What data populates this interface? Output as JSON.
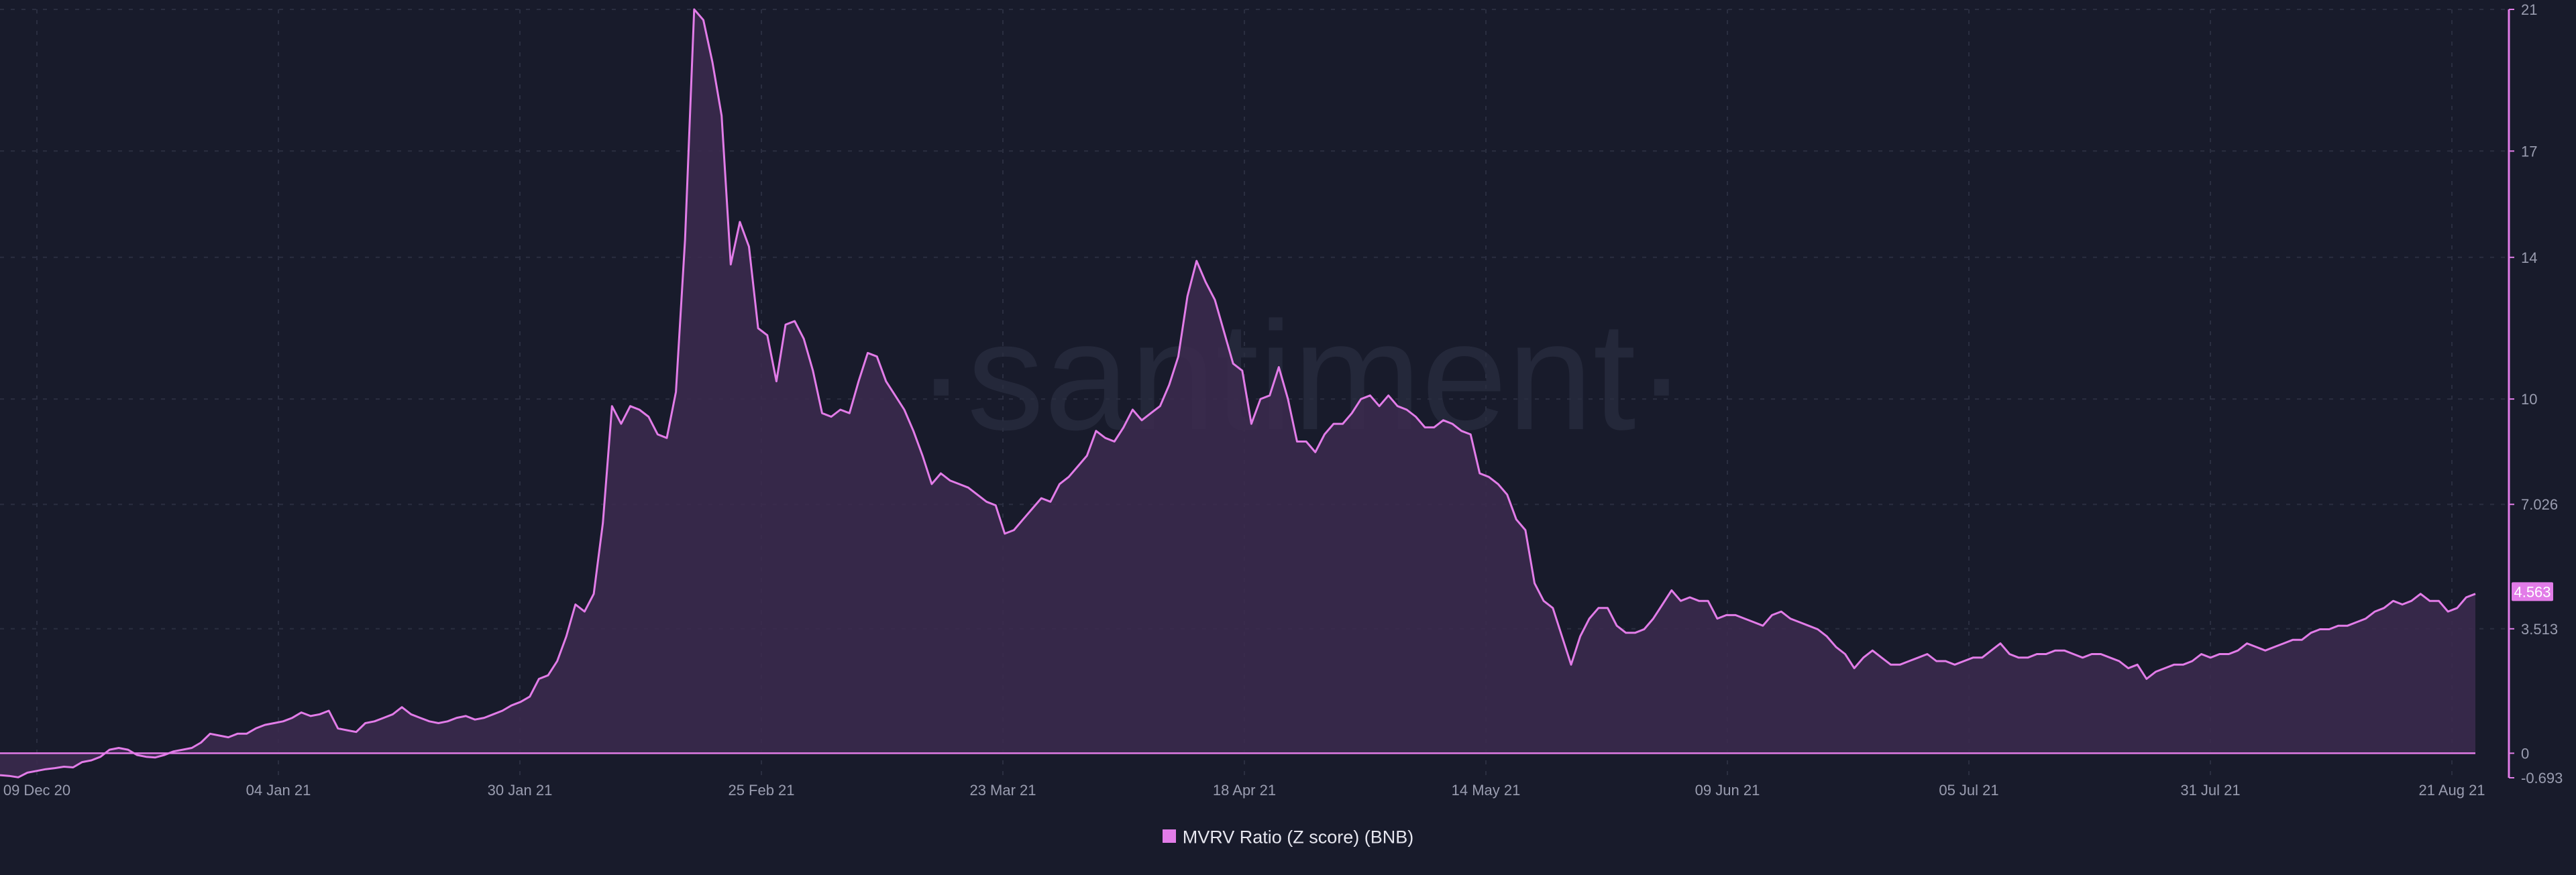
{
  "chart_data": {
    "type": "area",
    "watermark": "·santiment·",
    "x_ticks": [
      "09 Dec 20",
      "04 Jan 21",
      "30 Jan 21",
      "25 Feb 21",
      "23 Mar 21",
      "18 Apr 21",
      "14 May 21",
      "09 Jun 21",
      "05 Jul 21",
      "31 Jul 21",
      "21 Aug 21"
    ],
    "y_ticks": [
      21,
      17,
      14,
      10,
      7.026,
      3.513,
      0,
      -0.693
    ],
    "ylim": [
      -0.693,
      21
    ],
    "current_value": "4.563",
    "legend_position": "bottom-center",
    "grid": true,
    "colors": {
      "background": "#181b2b",
      "line": "#e27ce8",
      "fill": "#3c2a4f",
      "grid": "#2a2e40"
    },
    "series": [
      {
        "name": "MVRV Ratio (Z score) (BNB)",
        "x_start": "2020-12-09",
        "x_end": "2021-08-21",
        "values": [
          -0.62,
          -0.64,
          -0.68,
          -0.55,
          -0.5,
          -0.45,
          -0.42,
          -0.38,
          -0.4,
          -0.25,
          -0.2,
          -0.1,
          0.1,
          0.15,
          0.1,
          -0.05,
          -0.1,
          -0.12,
          -0.05,
          0.05,
          0.1,
          0.15,
          0.3,
          0.55,
          0.5,
          0.45,
          0.55,
          0.55,
          0.7,
          0.8,
          0.85,
          0.9,
          1.0,
          1.15,
          1.05,
          1.1,
          1.2,
          0.7,
          0.65,
          0.6,
          0.85,
          0.9,
          1.0,
          1.1,
          1.3,
          1.1,
          1.0,
          0.9,
          0.85,
          0.9,
          1.0,
          1.05,
          0.95,
          1.0,
          1.1,
          1.2,
          1.35,
          1.45,
          1.6,
          2.1,
          2.2,
          2.6,
          3.3,
          4.2,
          4.0,
          4.5,
          6.5,
          9.8,
          9.3,
          9.8,
          9.7,
          9.5,
          9.0,
          8.9,
          10.2,
          14.5,
          21.0,
          20.7,
          19.5,
          18.0,
          13.8,
          15.0,
          14.3,
          12.0,
          11.8,
          10.5,
          12.1,
          12.2,
          11.7,
          10.8,
          9.6,
          9.5,
          9.7,
          9.6,
          10.5,
          11.3,
          11.2,
          10.5,
          10.1,
          9.7,
          9.1,
          8.4,
          7.6,
          7.9,
          7.7,
          7.6,
          7.5,
          7.3,
          7.1,
          7.0,
          6.2,
          6.3,
          6.6,
          6.9,
          7.2,
          7.1,
          7.6,
          7.8,
          8.1,
          8.4,
          9.1,
          8.9,
          8.8,
          9.2,
          9.7,
          9.4,
          9.6,
          9.8,
          10.4,
          11.2,
          12.9,
          13.9,
          13.3,
          12.8,
          11.9,
          11.0,
          10.8,
          9.3,
          10.0,
          10.1,
          10.9,
          10.0,
          8.8,
          8.8,
          8.5,
          9.0,
          9.3,
          9.3,
          9.6,
          10.0,
          10.1,
          9.8,
          10.1,
          9.8,
          9.7,
          9.5,
          9.2,
          9.2,
          9.4,
          9.3,
          9.1,
          9.0,
          7.9,
          7.8,
          7.6,
          7.3,
          6.6,
          6.3,
          4.8,
          4.3,
          4.1,
          3.3,
          2.5,
          3.3,
          3.8,
          4.1,
          4.1,
          3.6,
          3.4,
          3.4,
          3.5,
          3.8,
          4.2,
          4.6,
          4.3,
          4.4,
          4.3,
          4.3,
          3.8,
          3.9,
          3.9,
          3.8,
          3.7,
          3.6,
          3.9,
          4.0,
          3.8,
          3.7,
          3.6,
          3.5,
          3.3,
          3.0,
          2.8,
          2.4,
          2.7,
          2.9,
          2.7,
          2.5,
          2.5,
          2.6,
          2.7,
          2.8,
          2.6,
          2.6,
          2.5,
          2.6,
          2.7,
          2.7,
          2.9,
          3.1,
          2.8,
          2.7,
          2.7,
          2.8,
          2.8,
          2.9,
          2.9,
          2.8,
          2.7,
          2.8,
          2.8,
          2.7,
          2.6,
          2.4,
          2.5,
          2.1,
          2.3,
          2.4,
          2.5,
          2.5,
          2.6,
          2.8,
          2.7,
          2.8,
          2.8,
          2.9,
          3.1,
          3.0,
          2.9,
          3.0,
          3.1,
          3.2,
          3.2,
          3.4,
          3.5,
          3.5,
          3.6,
          3.6,
          3.7,
          3.8,
          4.0,
          4.1,
          4.3,
          4.2,
          4.3,
          4.5,
          4.3,
          4.3,
          4.0,
          4.1,
          4.4,
          4.5
        ]
      }
    ]
  }
}
